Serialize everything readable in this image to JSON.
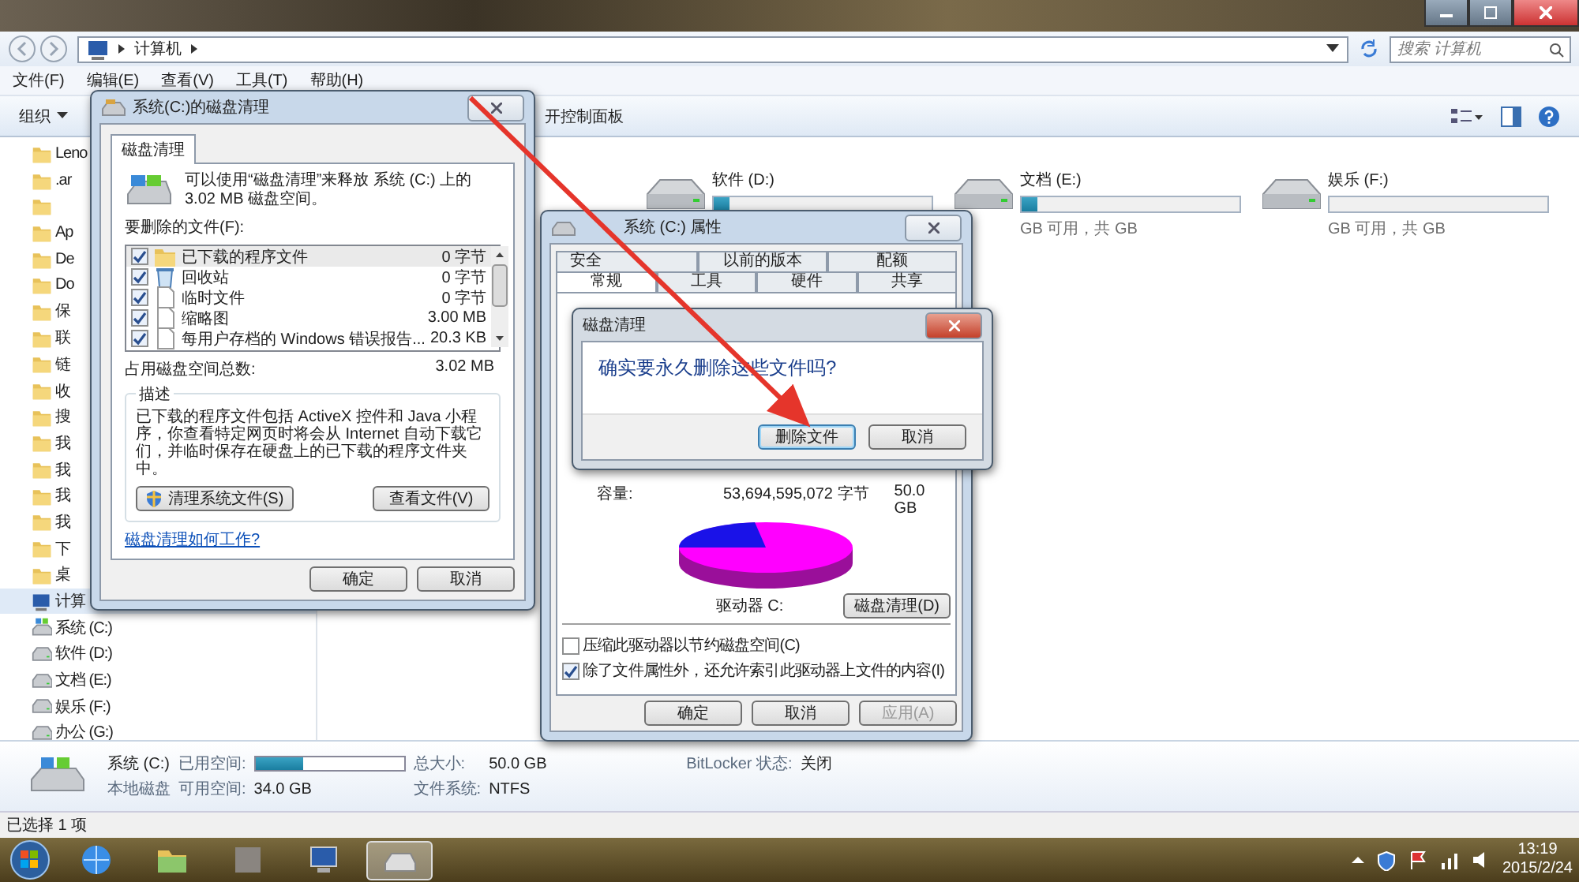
{
  "explorer": {
    "address": "计算机",
    "search_placeholder": "搜索 计算机",
    "menu": [
      "文件(F)",
      "编辑(E)",
      "查看(V)",
      "工具(T)",
      "帮助(H)"
    ],
    "toolbar": {
      "organize": "组织",
      "control_panel": "开控制面板"
    },
    "sidebar": [
      {
        "kind": "folder",
        "label": "Leno",
        "selected": false
      },
      {
        "kind": "folder",
        "label": ".ar",
        "selected": false
      },
      {
        "kind": "folder",
        "selected": false
      },
      {
        "kind": "folder",
        "label": "Ap",
        "selected": false
      },
      {
        "kind": "folder",
        "label": "De",
        "selected": false
      },
      {
        "kind": "folder",
        "label": "Do",
        "selected": false
      },
      {
        "kind": "folder",
        "label": "保",
        "selected": false
      },
      {
        "kind": "folder",
        "label": "联",
        "selected": false
      },
      {
        "kind": "folder",
        "label": "链",
        "selected": false
      },
      {
        "kind": "folder",
        "label": "收",
        "selected": false
      },
      {
        "kind": "folder",
        "label": "搜",
        "selected": false
      },
      {
        "kind": "folder",
        "label": "我",
        "selected": false
      },
      {
        "kind": "folder",
        "label": "我",
        "selected": false
      },
      {
        "kind": "folder",
        "label": "我",
        "selected": false
      },
      {
        "kind": "folder",
        "label": "我",
        "selected": false
      },
      {
        "kind": "folder",
        "label": "下",
        "selected": false
      },
      {
        "kind": "folder",
        "label": "桌",
        "selected": false
      },
      {
        "kind": "computer",
        "label": "计算",
        "selected": true
      },
      {
        "kind": "system",
        "label": "系统 (C:)",
        "selected": false
      },
      {
        "kind": "drive",
        "label": "软件 (D:)",
        "selected": false
      },
      {
        "kind": "drive",
        "label": "文档 (E:)",
        "selected": false
      },
      {
        "kind": "drive",
        "label": "娱乐 (F:)",
        "selected": false
      },
      {
        "kind": "drive",
        "label": "办公 (G:)",
        "selected": false
      }
    ],
    "drives": [
      {
        "name": "软件 (D:)",
        "level": 0.07
      },
      {
        "name": "文档 (E:)",
        "level": 0.07,
        "free": "GB 可用，共 GB"
      },
      {
        "name": "娱乐 (F:)",
        "level": 0,
        "free": "GB 可用，共 GB"
      }
    ],
    "details": {
      "name": "系统 (C:)",
      "type": "本地磁盘",
      "used_label": "已用空间:",
      "level": 0.32,
      "free_label": "可用空间:",
      "free": "34.0 GB",
      "total_label": "总大小:",
      "total": "50.0 GB",
      "fs_label": "文件系统:",
      "fs": "NTFS",
      "bitlocker_label": "BitLocker 状态:",
      "bitlocker": "关闭"
    },
    "status": "已选择 1 项"
  },
  "cleanup_dialog": {
    "title": "系统(C:)的磁盘清理",
    "tab": "磁盘清理",
    "intro": "可以使用“磁盘清理”来释放 系统 (C:) 上的 3.02 MB 磁盘空间。",
    "list_label": "要删除的文件(F):",
    "files": [
      {
        "kind": "folder",
        "name": "已下载的程序文件",
        "size": "0 字节",
        "checked": true,
        "selected": true
      },
      {
        "kind": "bin",
        "name": "回收站",
        "size": "0 字节",
        "checked": true,
        "selected": false
      },
      {
        "kind": "page",
        "name": "临时文件",
        "size": "0 字节",
        "checked": true,
        "selected": false
      },
      {
        "kind": "page",
        "name": "缩略图",
        "size": "3.00 MB",
        "checked": true,
        "selected": false
      },
      {
        "kind": "page",
        "name": "每用户存档的 Windows 错误报告...",
        "size": "20.3 KB",
        "checked": true,
        "selected": false
      }
    ],
    "total_label": "占用磁盘空间总数:",
    "total": "3.02 MB",
    "description_title": "描述",
    "description": "已下载的程序文件包括 ActiveX 控件和 Java 小程序，你查看特定网页时将会从 Internet 自动下载它们，并临时保存在硬盘上的已下载的程序文件夹中。",
    "clean_system_button": "清理系统文件(S)",
    "view_files_button": "查看文件(V)",
    "help_link": "磁盘清理如何工作?",
    "ok": "确定",
    "cancel": "取消"
  },
  "properties_dialog": {
    "title": "系统 (C:) 属性",
    "tab_rows": [
      [
        {
          "label": "安全",
          "selected": false
        },
        {
          "label": "以前的版本",
          "selected": false
        },
        {
          "label": "配额",
          "selected": false
        }
      ],
      [
        {
          "label": "常规",
          "selected": true
        },
        {
          "label": "工具",
          "selected": false
        },
        {
          "label": "硬件",
          "selected": false
        },
        {
          "label": "共享",
          "selected": false
        }
      ]
    ],
    "capacity_label": "容量:",
    "capacity_bytes": "53,694,595,072 字节",
    "capacity": "50.0 GB",
    "drive_label": "驱动器 C:",
    "cleanup_button": "磁盘清理(D)",
    "options": [
      {
        "label": "压缩此驱动器以节约磁盘空间(C)",
        "checked": false
      },
      {
        "label": "除了文件属性外，还允许索引此驱动器上文件的内容(I)",
        "checked": true
      }
    ],
    "buttons": [
      {
        "label": "确定",
        "disabled": false
      },
      {
        "label": "取消",
        "disabled": false
      },
      {
        "label": "应用(A)",
        "disabled": true
      }
    ]
  },
  "confirm_dialog": {
    "title": "磁盘清理",
    "message": "确实要永久删除这些文件吗?",
    "buttons": [
      {
        "label": "删除文件",
        "focused": true
      },
      {
        "label": "取消",
        "focused": false
      }
    ]
  },
  "taskbar": {
    "apps": [
      {
        "kind": "browser",
        "active": false
      },
      {
        "kind": "folder",
        "active": false
      },
      {
        "kind": "blank",
        "active": false
      },
      {
        "kind": "computer",
        "active": false
      },
      {
        "kind": "drive",
        "active": true
      }
    ],
    "time": "13:19",
    "date": "2015/2/24"
  }
}
